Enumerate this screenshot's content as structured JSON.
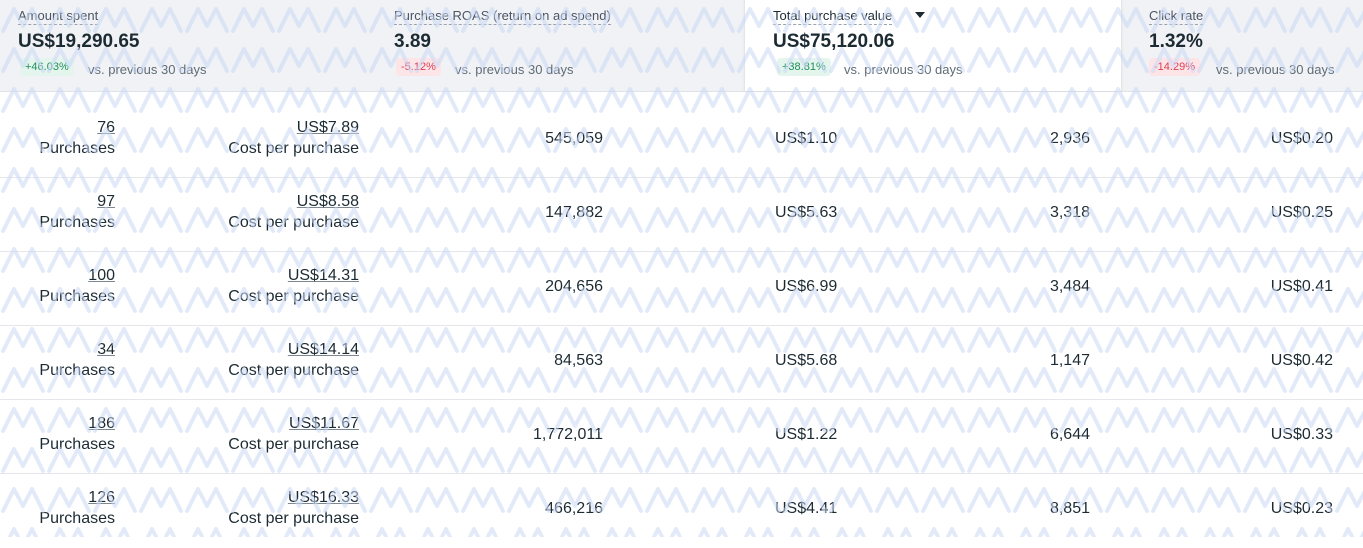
{
  "metrics": [
    {
      "label": "Amount spent",
      "value": "US$19,290.65",
      "delta": "+46.03%",
      "trend": "up",
      "compare": "vs. previous 30 days"
    },
    {
      "label": "Purchase ROAS (return on ad spend)",
      "value": "3.89",
      "delta": "-5.12%",
      "trend": "down",
      "compare": "vs. previous 30 days"
    },
    {
      "label": "Total purchase value",
      "value": "US$75,120.06",
      "delta": "+38.81%",
      "trend": "up",
      "compare": "vs. previous 30 days",
      "selected": true
    },
    {
      "label": "Click rate",
      "value": "1.32%",
      "delta": "-14.29%",
      "trend": "down",
      "compare": "vs. previous 30 days"
    }
  ],
  "table": {
    "purchases_label": "Purchases",
    "cost_per_purchase_label": "Cost per purchase",
    "rows": [
      {
        "purchases": "76",
        "cost_per_purchase": "US$7.89",
        "impressions": "545,059",
        "cpm": "US$1.10",
        "clicks": "2,936",
        "cpc": "US$0.20"
      },
      {
        "purchases": "97",
        "cost_per_purchase": "US$8.58",
        "impressions": "147,882",
        "cpm": "US$5.63",
        "clicks": "3,318",
        "cpc": "US$0.25"
      },
      {
        "purchases": "100",
        "cost_per_purchase": "US$14.31",
        "impressions": "204,656",
        "cpm": "US$6.99",
        "clicks": "3,484",
        "cpc": "US$0.41"
      },
      {
        "purchases": "34",
        "cost_per_purchase": "US$14.14",
        "impressions": "84,563",
        "cpm": "US$5.68",
        "clicks": "1,147",
        "cpc": "US$0.42"
      },
      {
        "purchases": "186",
        "cost_per_purchase": "US$11.67",
        "impressions": "1,772,011",
        "cpm": "US$1.22",
        "clicks": "6,644",
        "cpc": "US$0.33"
      },
      {
        "purchases": "126",
        "cost_per_purchase": "US$16.33",
        "impressions": "466,216",
        "cpm": "US$4.41",
        "clicks": "8,851",
        "cpc": "US$0.23"
      }
    ]
  },
  "colors": {
    "positive": "#1e8e5a",
    "negative": "#d93f55",
    "watermark": "#c9d8f5"
  },
  "icons": {
    "sort": "caret-down-icon"
  }
}
